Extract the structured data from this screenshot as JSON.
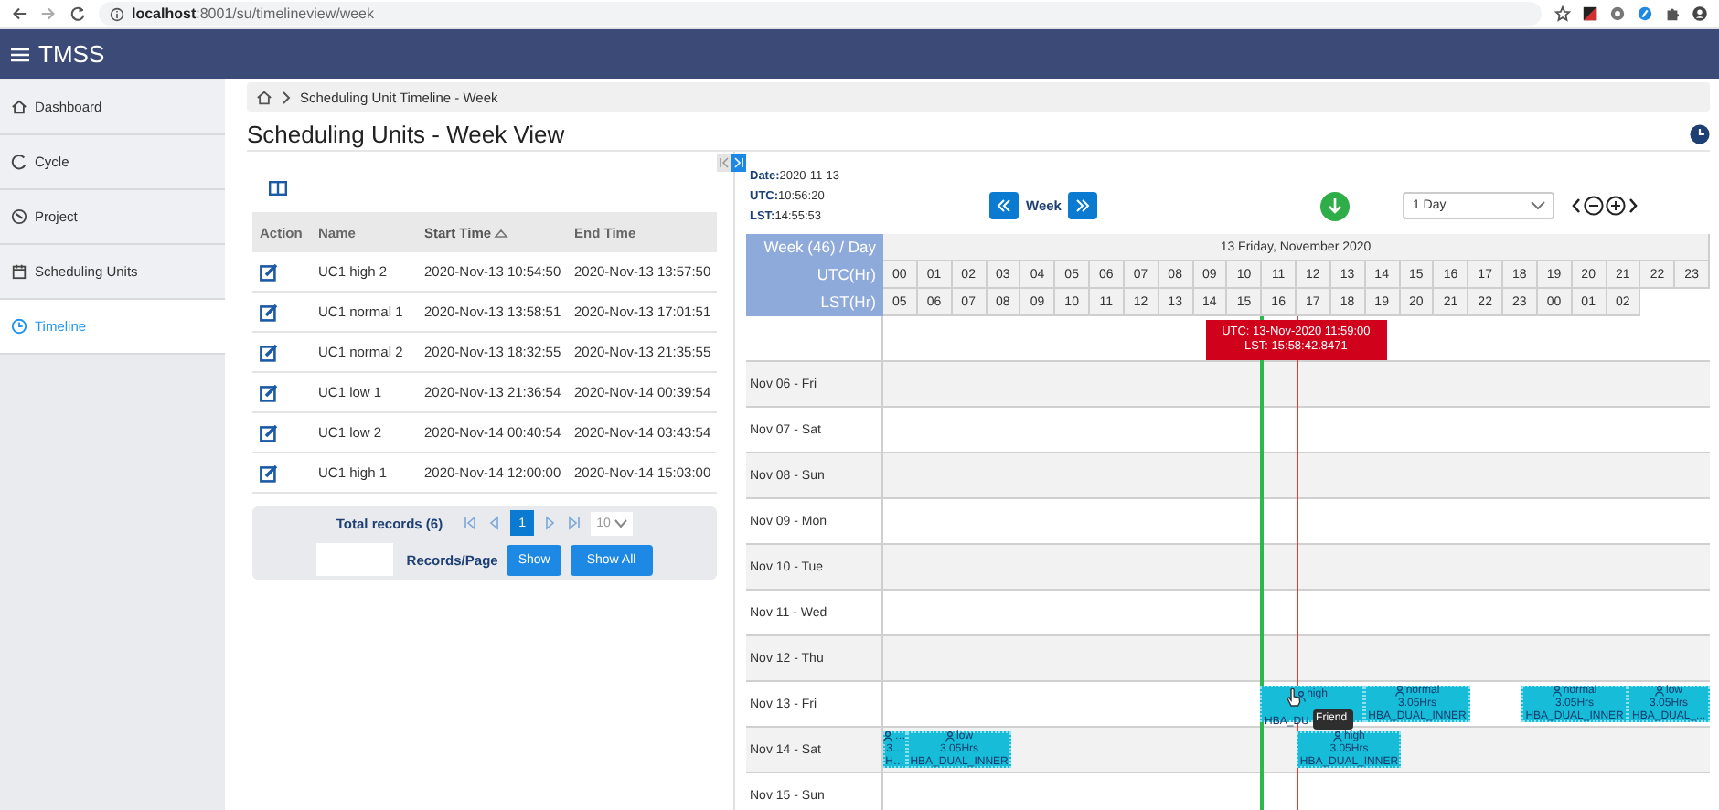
{
  "browser": {
    "url_host": "localhost",
    "url_path": ":8001/su/timelineview/week"
  },
  "app": {
    "title": "TMSS"
  },
  "sidebar": {
    "items": [
      {
        "label": "Dashboard",
        "kind": "home",
        "selected": false
      },
      {
        "label": "Cycle",
        "kind": "cycle",
        "selected": false
      },
      {
        "label": "Project",
        "kind": "project",
        "selected": false
      },
      {
        "label": "Scheduling Units",
        "kind": "calendar",
        "selected": false
      },
      {
        "label": "Timeline",
        "kind": "clock",
        "selected": true
      }
    ]
  },
  "breadcrumb": {
    "text": "Scheduling Unit Timeline - Week"
  },
  "page_title": "Scheduling Units - Week View",
  "table": {
    "columns": [
      {
        "label": "Action",
        "sorted": false
      },
      {
        "label": "Name",
        "sorted": false
      },
      {
        "label": "Start Time",
        "sorted": true
      },
      {
        "label": "End Time",
        "sorted": false
      }
    ],
    "rows": [
      {
        "name": "UC1 high 2",
        "start": "2020-Nov-13 10:54:50",
        "end": "2020-Nov-13 13:57:50"
      },
      {
        "name": "UC1 normal 1",
        "start": "2020-Nov-13 13:58:51",
        "end": "2020-Nov-13 17:01:51"
      },
      {
        "name": "UC1 normal 2",
        "start": "2020-Nov-13 18:32:55",
        "end": "2020-Nov-13 21:35:55"
      },
      {
        "name": "UC1 low 1",
        "start": "2020-Nov-13 21:36:54",
        "end": "2020-Nov-14 00:39:54"
      },
      {
        "name": "UC1 low 2",
        "start": "2020-Nov-14 00:40:54",
        "end": "2020-Nov-14 03:43:54"
      },
      {
        "name": "UC1 high 1",
        "start": "2020-Nov-14 12:00:00",
        "end": "2020-Nov-14 15:03:00"
      }
    ]
  },
  "paginator": {
    "total": "Total records (6)",
    "pages": [
      {
        "label": "1",
        "selected": true
      }
    ],
    "page_size": "10",
    "records_label": "Records/Page",
    "buttons": [
      "Show",
      "Show All"
    ]
  },
  "timeline": {
    "date_label": "Date:",
    "date": "2020-11-13",
    "utc_label": "UTC:",
    "utc": "10:56:20",
    "lst_label": "LST:",
    "lst": "14:55:53",
    "nav_label": "Week",
    "zoom": "1 Day",
    "header_label": "Week (46) / Day",
    "utc_row_label": "UTC(Hr)",
    "lst_row_label": "LST(Hr)",
    "day_title": "13 Friday, November 2020",
    "utc_hours": [
      "00",
      "01",
      "02",
      "03",
      "04",
      "05",
      "06",
      "07",
      "08",
      "09",
      "10",
      "11",
      "12",
      "13",
      "14",
      "15",
      "16",
      "17",
      "18",
      "19",
      "20",
      "21",
      "22",
      "23"
    ],
    "lst_hours": [
      "05",
      "06",
      "07",
      "08",
      "09",
      "10",
      "11",
      "12",
      "13",
      "14",
      "15",
      "16",
      "17",
      "18",
      "19",
      "20",
      "21",
      "22",
      "23",
      "00",
      "01",
      "02"
    ],
    "marker": {
      "utc": "UTC: 13-Nov-2020 11:59:00",
      "lst": "LST: 15:58:42.8471"
    },
    "days": [
      {
        "label": "Nov 06 - Fri"
      },
      {
        "label": "Nov 07 - Sat"
      },
      {
        "label": "Nov 08 - Sun"
      },
      {
        "label": "Nov 09 - Mon"
      },
      {
        "label": "Nov 10 - Tue"
      },
      {
        "label": "Nov 11 - Wed"
      },
      {
        "label": "Nov 12 - Thu"
      },
      {
        "label": "Nov 13 - Fri",
        "blocks": [
          {
            "title": "high",
            "obs": "HBA_DU",
            "tooltip": "Friend"
          },
          {
            "title": "normal",
            "duration": "3.05Hrs",
            "obs": "HBA_DUAL_INNER"
          },
          {
            "title": "normal",
            "duration": "3.05Hrs",
            "obs": "HBA_DUAL_INNER"
          },
          {
            "title": "low",
            "duration": "3.05Hrs",
            "obs": "HBA_DUAL_..."
          }
        ]
      },
      {
        "label": "Nov 14 - Sat",
        "blocks": [
          {
            "title": "…",
            "duration": "3…",
            "obs": "H…"
          },
          {
            "title": "low",
            "duration": "3.05Hrs",
            "obs": "HBA_DUAL_INNER"
          },
          {
            "title": "high",
            "duration": "3.05Hrs",
            "obs": "HBA_DUAL_INNER"
          }
        ]
      },
      {
        "label": "Nov 15 - Sun"
      }
    ]
  }
}
